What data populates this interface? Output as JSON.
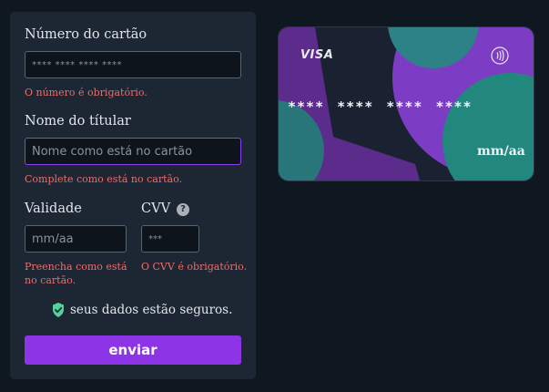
{
  "form": {
    "card_number": {
      "label": "Número do cartão",
      "placeholder": "**** **** **** ****",
      "error": "O número é obrigatório."
    },
    "holder_name": {
      "label": "Nome do títular",
      "placeholder": "Nome como está no cartão",
      "error": "Complete como está no cartão."
    },
    "expiry": {
      "label": "Validade",
      "placeholder": "mm/aa",
      "error_line1": "Preencha como está",
      "error_line2": "no cartão."
    },
    "cvv": {
      "label": "CVV",
      "help_icon": "?",
      "placeholder": "***",
      "error": "O CVV é obrigatório."
    },
    "secure_text": "seus dados estão seguros.",
    "submit_label": "enviar"
  },
  "card_preview": {
    "brand": "VISA",
    "number": "**** **** **** ****",
    "expiry": "mm/aa"
  },
  "colors": {
    "background": "#0f1720",
    "panel": "#1c2733",
    "accent": "#8d35e6",
    "error": "#ee6b6b",
    "focus_border": "#8b3ff0",
    "card_purple": "#7d3cc4",
    "card_teal": "#26877f",
    "shield": "#52d19a"
  },
  "icons": {
    "help": "question-circle-icon",
    "shield": "shield-check-icon",
    "contactless": "contactless-icon"
  }
}
